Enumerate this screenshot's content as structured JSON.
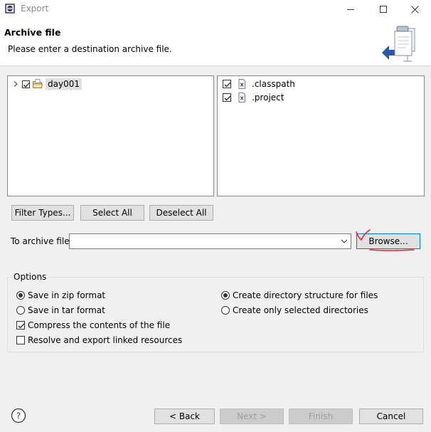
{
  "window": {
    "title": "Export"
  },
  "banner": {
    "title": "Archive file",
    "description": "Please enter a destination archive file.",
    "icon": "export-wizard-icon"
  },
  "tree_left": {
    "items": [
      {
        "label": "day001",
        "checked": true,
        "expanded": false,
        "icon": "project-folder-icon"
      }
    ]
  },
  "tree_right": {
    "items": [
      {
        "label": ".classpath",
        "checked": true,
        "icon": "xml-file-icon"
      },
      {
        "label": ".project",
        "checked": true,
        "icon": "xml-file-icon"
      }
    ]
  },
  "selection_buttons": {
    "filter_types": "Filter Types...",
    "select_all": "Select All",
    "deselect_all": "Deselect All"
  },
  "archive": {
    "label": "To archive file:",
    "value": "",
    "browse": "Browse..."
  },
  "options": {
    "title": "Options",
    "save_zip": {
      "label": "Save in zip format",
      "selected": true
    },
    "save_tar": {
      "label": "Save in tar format",
      "selected": false
    },
    "compress": {
      "label": "Compress the contents of the file",
      "checked": true
    },
    "resolve_links": {
      "label": "Resolve and export linked resources",
      "checked": false
    },
    "create_dir_structure": {
      "label": "Create directory structure for files",
      "selected": true
    },
    "create_selected_dirs": {
      "label": "Create only selected directories",
      "selected": false
    }
  },
  "footer": {
    "back": "< Back",
    "next": "Next >",
    "finish": "Finish",
    "cancel": "Cancel"
  },
  "colors": {
    "annotation": "#e8212a",
    "focus_border": "#0078d7"
  }
}
